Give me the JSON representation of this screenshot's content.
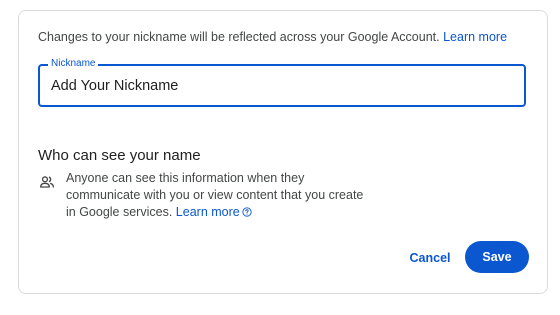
{
  "intro": {
    "text": "Changes to your nickname will be reflected across your Google Account.",
    "learn_more": "Learn more"
  },
  "nickname_field": {
    "label": "Nickname",
    "value": "",
    "placeholder": "Add Your Nickname"
  },
  "visibility": {
    "title": "Who can see your name",
    "icon": "people-icon",
    "description": "Anyone can see this information when they communicate with you or view content that you create in Google services.",
    "learn_more": "Learn more",
    "help_icon": "help-circle-icon"
  },
  "actions": {
    "cancel_label": "Cancel",
    "save_label": "Save"
  },
  "colors": {
    "accent": "#0b57d0",
    "text_primary": "#1f1f1f",
    "text_secondary": "#444746",
    "border": "#dadce0"
  }
}
